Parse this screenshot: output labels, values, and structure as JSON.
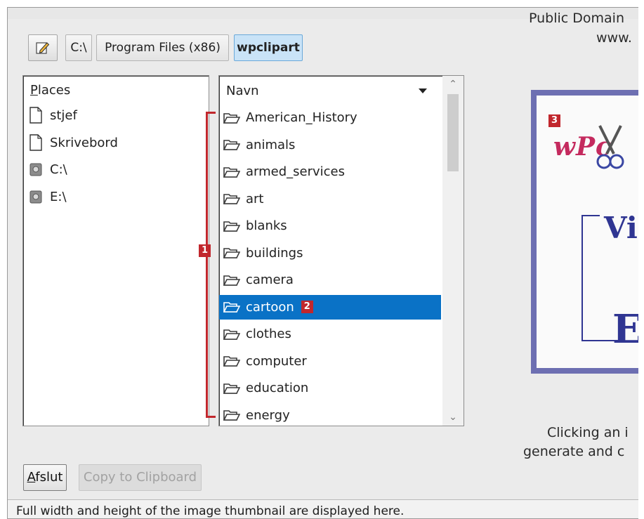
{
  "toolbar": {
    "edit_icon": "pencil-edit-icon",
    "breadcrumbs": [
      "C:\\",
      "Program Files (x86)",
      "wpclipart"
    ]
  },
  "places": {
    "header_first": "P",
    "header_rest": "laces",
    "items": [
      {
        "label": "stjef",
        "icon": "document-icon"
      },
      {
        "label": "Skrivebord",
        "icon": "document-icon"
      },
      {
        "label": "C:\\",
        "icon": "drive-icon"
      },
      {
        "label": "E:\\",
        "icon": "drive-icon"
      }
    ]
  },
  "navigator": {
    "header": "Navn",
    "folders": [
      "American_History",
      "animals",
      "armed_services",
      "art",
      "blanks",
      "buildings",
      "camera",
      "cartoon",
      "clothes",
      "computer",
      "education",
      "energy"
    ],
    "selected_folder": "cartoon",
    "folder_icon": "folder-icon"
  },
  "annotations": {
    "badge1": "1",
    "badge2": "2",
    "badge3": "3"
  },
  "preview": {
    "caption_line1": "Public Domain",
    "caption_line2": "www.",
    "thumb_logo_text": "wPc",
    "thumb_vi_text": "Vi",
    "thumb_e_text": "E",
    "click_line1": "Clicking an i",
    "click_line2": "generate and c"
  },
  "buttons": {
    "quit_first": "A",
    "quit_rest": "fslut",
    "copy": "Copy to Clipboard"
  },
  "status": {
    "text": "Full width and height of the image thumbnail are displayed here."
  },
  "colors": {
    "selection": "#0a72c6",
    "annotation_red": "#c1272d",
    "thumbnail_border": "#6d6fb2",
    "active_crumb": "#c9e3f7"
  }
}
